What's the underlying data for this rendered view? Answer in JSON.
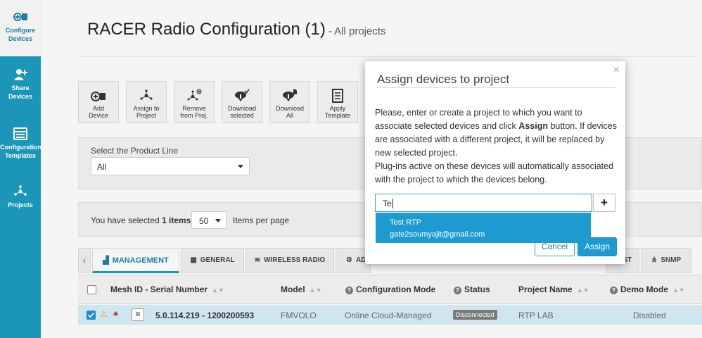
{
  "sidebar": {
    "items": [
      {
        "label_1": "Configure",
        "label_2": "Devices",
        "icon": "configure-devices-icon",
        "active": true
      },
      {
        "label_1": "Share",
        "label_2": "Devices",
        "icon": "share-devices-icon"
      },
      {
        "label_1": "Configuration",
        "label_2": "Templates",
        "icon": "templates-icon"
      },
      {
        "label_1": "Projects",
        "label_2": "",
        "icon": "projects-icon"
      }
    ]
  },
  "header": {
    "title": "RACER Radio Configuration (1)",
    "subtitle": "- All projects"
  },
  "toolbar": {
    "buttons": [
      {
        "line1": "Add",
        "line2": "Device",
        "icon": "add-device-icon"
      },
      {
        "line1": "Assign to",
        "line2": "Project",
        "icon": "assign-project-icon"
      },
      {
        "line1": "Remove",
        "line2": "from Proj.",
        "icon": "remove-project-icon"
      },
      {
        "line1": "Download",
        "line2": "selected",
        "icon": "download-selected-icon"
      },
      {
        "line1": "Download",
        "line2": "All",
        "icon": "download-all-icon"
      },
      {
        "line1": "Apply",
        "line2": "Template",
        "icon": "apply-template-icon"
      }
    ]
  },
  "product_line": {
    "label": "Select the Product Line",
    "value": "All"
  },
  "selection": {
    "prefix": "You have selected",
    "count_text": "1 items",
    "per_page": "50",
    "per_page_label": "Items per page"
  },
  "tabs": [
    {
      "label": "MANAGEMENT",
      "icon": "management-icon",
      "active": true
    },
    {
      "label": "GENERAL",
      "icon": "grid-icon"
    },
    {
      "label": "WIRELESS RADIO",
      "icon": "wifi-icon"
    },
    {
      "label": "AD",
      "icon": "settings-icon"
    },
    {
      "label": "ST",
      "icon": ""
    },
    {
      "label": "SNMP",
      "icon": "network-icon"
    }
  ],
  "table": {
    "columns": [
      "Mesh ID - Serial Number",
      "Model",
      "Configuration Mode",
      "Status",
      "Project Name",
      "Demo Mode"
    ],
    "rows": [
      {
        "serial": "5.0.114.219 - 1200200593",
        "model": "FMVOLO",
        "mode": "Online Cloud-Managed",
        "status": "Disconnected",
        "project": "RTP LAB",
        "demo": "Disabled"
      }
    ]
  },
  "modal": {
    "title": "Assign devices to project",
    "body_1": "Please, enter or create a project to which you want to associate selected devices and click",
    "body_bold": "Assign",
    "body_2": "button. If devices are associated with a different project, it will be replaced by new selected project.",
    "body_3": "Plug-ins active on these devices will automatically associated with the project to which the devices belong.",
    "input_value": "Te",
    "plus_label": "+",
    "suggestions": [
      "Test RTP",
      "gate2soumyajit@gmail.com"
    ],
    "cancel_label": "Cancel",
    "assign_label": "Assign",
    "close_label": "×"
  },
  "colors": {
    "accent": "#1b95b8",
    "primary_button": "#1d9bd1",
    "status_badge": "#7a7a7a"
  }
}
